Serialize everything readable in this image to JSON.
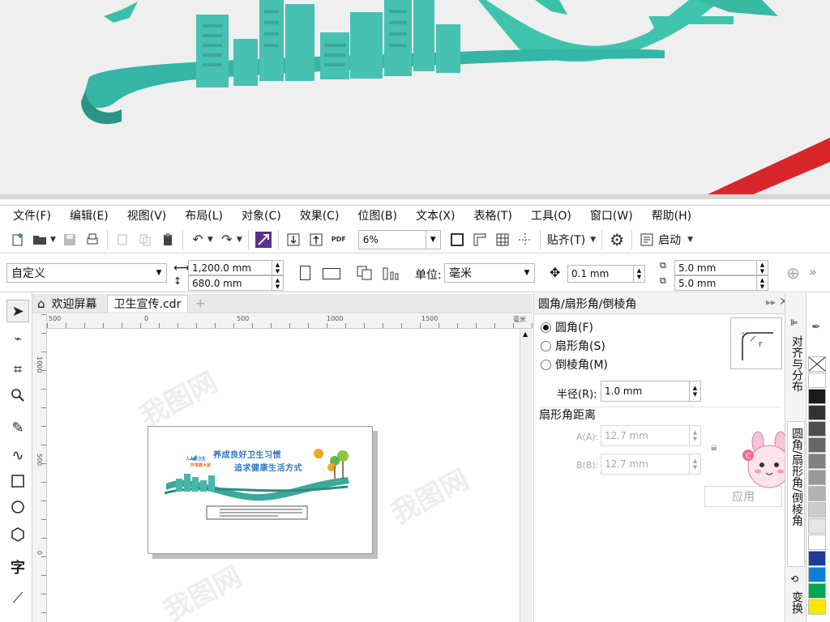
{
  "menubar": {
    "items": [
      "文件(F)",
      "编辑(E)",
      "视图(V)",
      "布局(L)",
      "对象(C)",
      "效果(C)",
      "位图(B)",
      "文本(X)",
      "表格(T)",
      "工具(O)",
      "窗口(W)",
      "帮助(H)"
    ]
  },
  "toolbar": {
    "zoom": "6%",
    "snap_label": "贴齐(T)",
    "launch_label": "启动",
    "pdf_label": "PDF"
  },
  "propbar": {
    "preset": "自定义",
    "width": "1,200.0 mm",
    "height": "680.0 mm",
    "units_label": "单位:",
    "units_value": "毫米",
    "nudge": "0.1 mm",
    "dup_x": "5.0 mm",
    "dup_y": "5.0 mm"
  },
  "tabs": {
    "welcome": "欢迎屏幕",
    "document": "卫生宣传.cdr"
  },
  "ruler": {
    "h_labels": [
      "500",
      "0",
      "500",
      "1000",
      "1500",
      "毫米"
    ],
    "v_labels": [
      "1000",
      "500",
      "0"
    ]
  },
  "artwork": {
    "headline1": "养成良好卫生习惯",
    "headline2": "追求健康生活方式",
    "small1": "人人讲卫生",
    "small2": "环境靠大家"
  },
  "docker": {
    "title": "圆角/扇形角/倒棱角",
    "option1": "圆角(F)",
    "option2": "扇形角(S)",
    "option3": "倒棱角(M)",
    "radius_label": "半径(R):",
    "radius_value": "1.0 mm",
    "distance_label": "扇形角距离",
    "a_label": "A(A):",
    "a_value": "12.7 mm",
    "b_label": "B(B):",
    "b_value": "12.7 mm",
    "apply_label": "应用"
  },
  "sidetabs": {
    "align": "对齐与分布",
    "fillet": "圆角/扇形角/倒棱角",
    "transform": "变换"
  },
  "palette": {
    "colors": [
      "#ffffff",
      "#1a1a1a",
      "#333333",
      "#4d4d4d",
      "#666666",
      "#808080",
      "#999999",
      "#b3b3b3",
      "#cccccc",
      "#e6e6e6",
      "#ffffff",
      "#1f3b99",
      "#0b7fd4",
      "#00a651",
      "#ffe600"
    ]
  },
  "watermark": "我图网"
}
